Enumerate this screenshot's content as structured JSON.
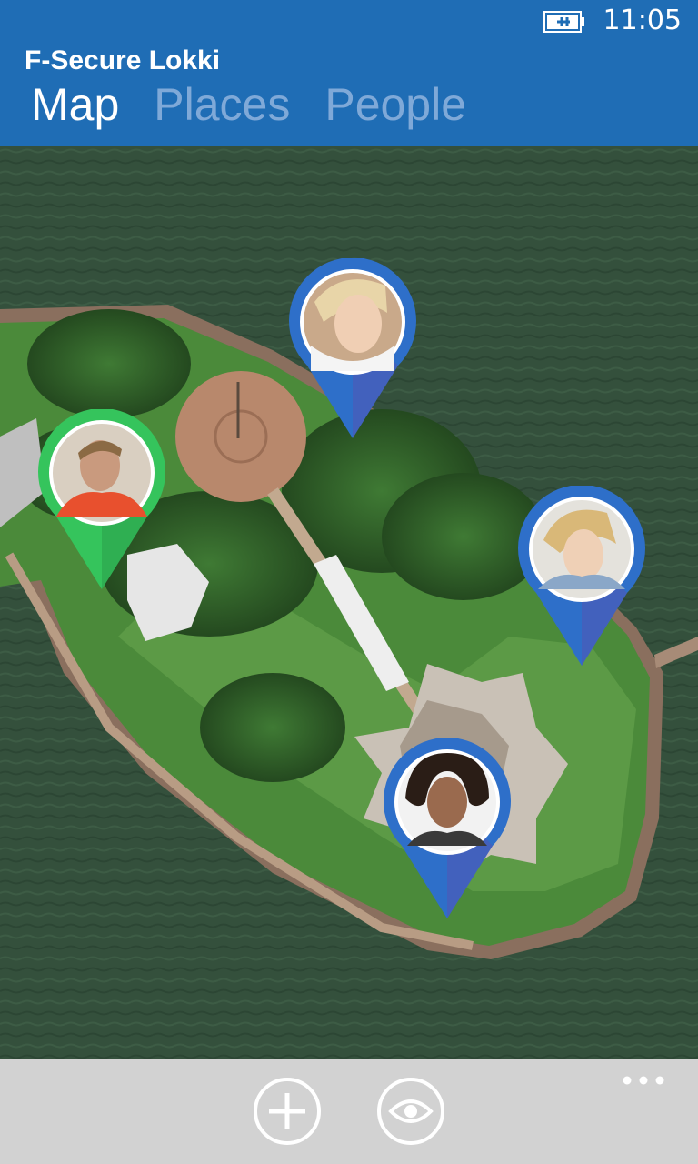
{
  "status": {
    "time": "11:05",
    "battery_icon": "battery-charging-icon"
  },
  "header": {
    "title": "F-Secure Lokki",
    "tabs": [
      {
        "label": "Map",
        "active": true
      },
      {
        "label": "Places",
        "active": false
      },
      {
        "label": "People",
        "active": false
      }
    ]
  },
  "map": {
    "pins": [
      {
        "color": "#3b9ee8",
        "person": "woman-blonde-profile"
      },
      {
        "color": "#3bd46a",
        "person": "man-orange-shirt"
      },
      {
        "color": "#3b9ee8",
        "person": "woman-headphones"
      },
      {
        "color": "#3b9ee8",
        "person": "woman-curly-hair"
      }
    ]
  },
  "app_bar": {
    "buttons": [
      {
        "icon": "add-icon"
      },
      {
        "icon": "eye-icon"
      }
    ],
    "more_icon": "more-icon"
  },
  "colors": {
    "accent": "#1f6db5",
    "app_bar": "#d2d2d2"
  }
}
